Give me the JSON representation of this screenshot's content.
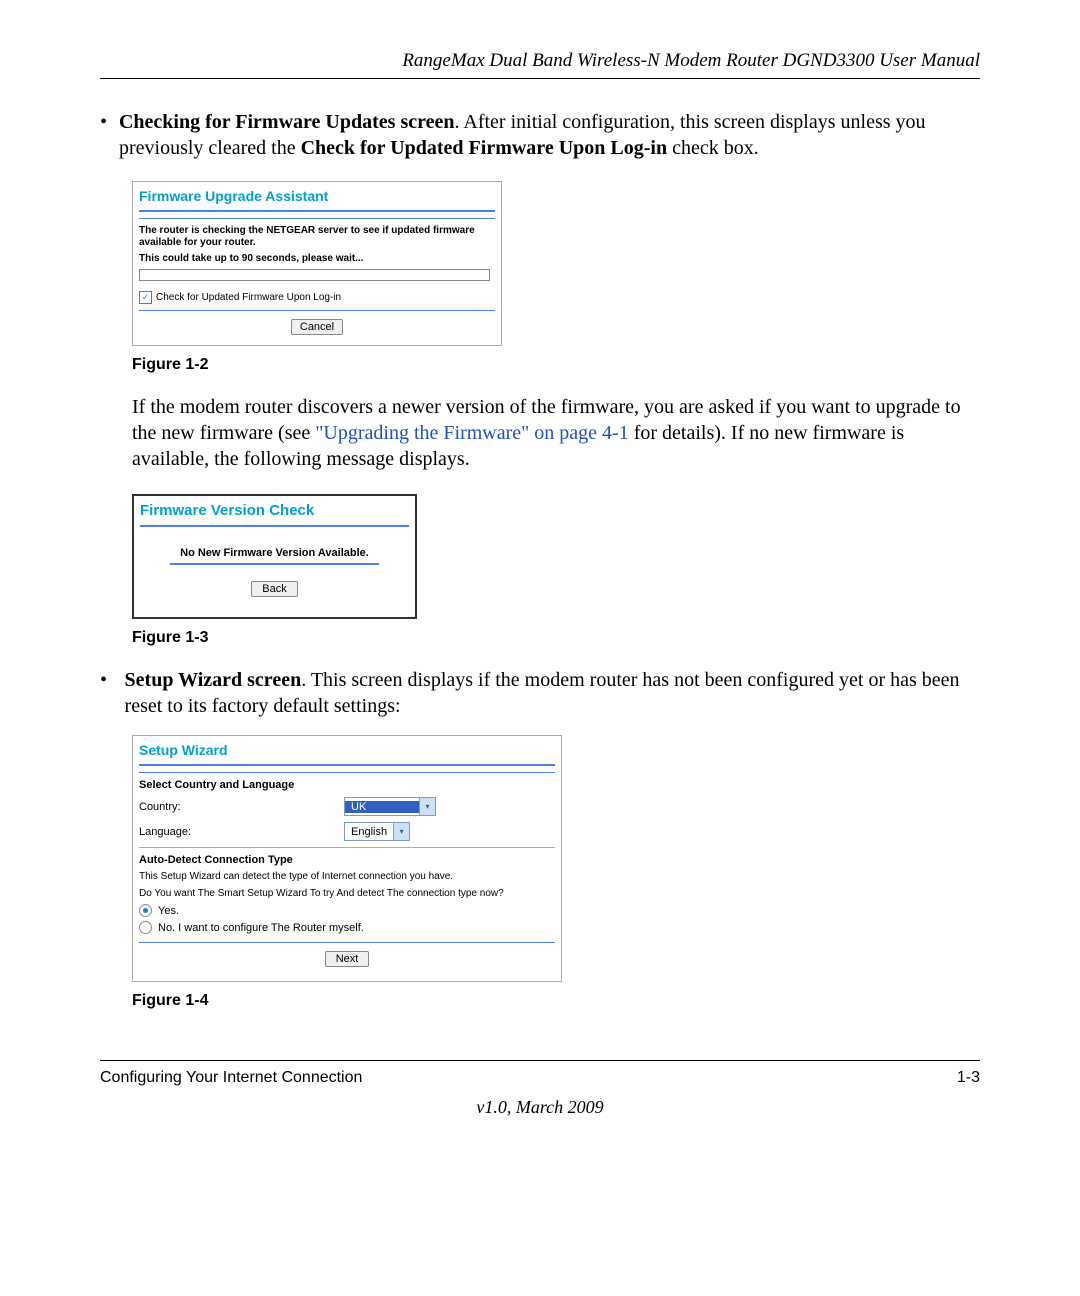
{
  "header": "RangeMax Dual Band Wireless-N Modem Router DGND3300 User Manual",
  "bullet1": {
    "strong1": "Checking for Firmware Updates screen",
    "text1": ". After initial configuration, this screen displays unless you previously cleared the ",
    "strong2": "Check for Updated Firmware Upon Log-in",
    "text2": " check box."
  },
  "fig12": {
    "title": "Firmware Upgrade Assistant",
    "msg1": "The router is checking the NETGEAR server to see if updated firmware available for your router.",
    "msg2": "This could take up to 90 seconds, please wait...",
    "checkbox_label": "Check for Updated Firmware Upon Log-in",
    "cancel": "Cancel",
    "caption": "Figure 1-2"
  },
  "para2": {
    "t1": "If the modem router discovers a newer version of the firmware, you are asked if you want to upgrade to the new firmware (see ",
    "link": "\"Upgrading the Firmware\" on page 4-1",
    "t2": " for details). If no new firmware is available, the following message displays."
  },
  "fig13": {
    "title": "Firmware Version Check",
    "msg": "No New Firmware Version Available.",
    "back": "Back",
    "caption": "Figure 1-3"
  },
  "bullet2": {
    "strong": "Setup Wizard screen",
    "text": ". This screen displays if the modem router has not been configured yet or has been reset to its factory default settings:"
  },
  "fig14": {
    "title": "Setup Wizard",
    "section1": "Select Country and Language",
    "country_label": "Country:",
    "country_value": "UK",
    "language_label": "Language:",
    "language_value": "English",
    "section2": "Auto-Detect Connection Type",
    "line1": "This Setup Wizard can detect the type of Internet connection you have.",
    "line2": "Do You want The Smart Setup Wizard To try And detect The connection type now?",
    "radio_yes": "Yes.",
    "radio_no": "No. I want to configure The Router myself.",
    "next": "Next",
    "caption": "Figure 1-4"
  },
  "footer": {
    "left": "Configuring Your Internet Connection",
    "right": "1-3",
    "version": "v1.0, March 2009"
  }
}
